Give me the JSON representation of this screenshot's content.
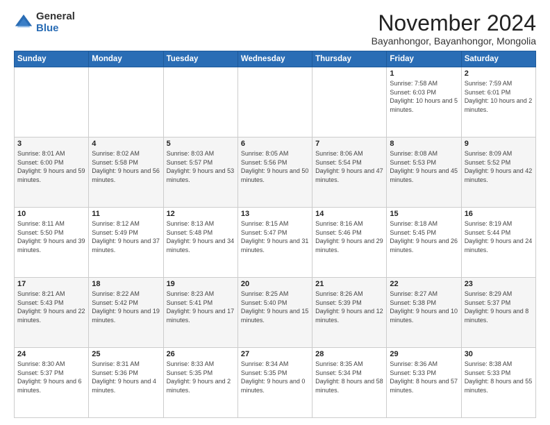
{
  "logo": {
    "general": "General",
    "blue": "Blue"
  },
  "header": {
    "month": "November 2024",
    "location": "Bayanhongor, Bayanhongor, Mongolia"
  },
  "weekdays": [
    "Sunday",
    "Monday",
    "Tuesday",
    "Wednesday",
    "Thursday",
    "Friday",
    "Saturday"
  ],
  "weeks": [
    [
      {
        "day": "",
        "info": ""
      },
      {
        "day": "",
        "info": ""
      },
      {
        "day": "",
        "info": ""
      },
      {
        "day": "",
        "info": ""
      },
      {
        "day": "",
        "info": ""
      },
      {
        "day": "1",
        "info": "Sunrise: 7:58 AM\nSunset: 6:03 PM\nDaylight: 10 hours\nand 5 minutes."
      },
      {
        "day": "2",
        "info": "Sunrise: 7:59 AM\nSunset: 6:01 PM\nDaylight: 10 hours\nand 2 minutes."
      }
    ],
    [
      {
        "day": "3",
        "info": "Sunrise: 8:01 AM\nSunset: 6:00 PM\nDaylight: 9 hours\nand 59 minutes."
      },
      {
        "day": "4",
        "info": "Sunrise: 8:02 AM\nSunset: 5:58 PM\nDaylight: 9 hours\nand 56 minutes."
      },
      {
        "day": "5",
        "info": "Sunrise: 8:03 AM\nSunset: 5:57 PM\nDaylight: 9 hours\nand 53 minutes."
      },
      {
        "day": "6",
        "info": "Sunrise: 8:05 AM\nSunset: 5:56 PM\nDaylight: 9 hours\nand 50 minutes."
      },
      {
        "day": "7",
        "info": "Sunrise: 8:06 AM\nSunset: 5:54 PM\nDaylight: 9 hours\nand 47 minutes."
      },
      {
        "day": "8",
        "info": "Sunrise: 8:08 AM\nSunset: 5:53 PM\nDaylight: 9 hours\nand 45 minutes."
      },
      {
        "day": "9",
        "info": "Sunrise: 8:09 AM\nSunset: 5:52 PM\nDaylight: 9 hours\nand 42 minutes."
      }
    ],
    [
      {
        "day": "10",
        "info": "Sunrise: 8:11 AM\nSunset: 5:50 PM\nDaylight: 9 hours\nand 39 minutes."
      },
      {
        "day": "11",
        "info": "Sunrise: 8:12 AM\nSunset: 5:49 PM\nDaylight: 9 hours\nand 37 minutes."
      },
      {
        "day": "12",
        "info": "Sunrise: 8:13 AM\nSunset: 5:48 PM\nDaylight: 9 hours\nand 34 minutes."
      },
      {
        "day": "13",
        "info": "Sunrise: 8:15 AM\nSunset: 5:47 PM\nDaylight: 9 hours\nand 31 minutes."
      },
      {
        "day": "14",
        "info": "Sunrise: 8:16 AM\nSunset: 5:46 PM\nDaylight: 9 hours\nand 29 minutes."
      },
      {
        "day": "15",
        "info": "Sunrise: 8:18 AM\nSunset: 5:45 PM\nDaylight: 9 hours\nand 26 minutes."
      },
      {
        "day": "16",
        "info": "Sunrise: 8:19 AM\nSunset: 5:44 PM\nDaylight: 9 hours\nand 24 minutes."
      }
    ],
    [
      {
        "day": "17",
        "info": "Sunrise: 8:21 AM\nSunset: 5:43 PM\nDaylight: 9 hours\nand 22 minutes."
      },
      {
        "day": "18",
        "info": "Sunrise: 8:22 AM\nSunset: 5:42 PM\nDaylight: 9 hours\nand 19 minutes."
      },
      {
        "day": "19",
        "info": "Sunrise: 8:23 AM\nSunset: 5:41 PM\nDaylight: 9 hours\nand 17 minutes."
      },
      {
        "day": "20",
        "info": "Sunrise: 8:25 AM\nSunset: 5:40 PM\nDaylight: 9 hours\nand 15 minutes."
      },
      {
        "day": "21",
        "info": "Sunrise: 8:26 AM\nSunset: 5:39 PM\nDaylight: 9 hours\nand 12 minutes."
      },
      {
        "day": "22",
        "info": "Sunrise: 8:27 AM\nSunset: 5:38 PM\nDaylight: 9 hours\nand 10 minutes."
      },
      {
        "day": "23",
        "info": "Sunrise: 8:29 AM\nSunset: 5:37 PM\nDaylight: 9 hours\nand 8 minutes."
      }
    ],
    [
      {
        "day": "24",
        "info": "Sunrise: 8:30 AM\nSunset: 5:37 PM\nDaylight: 9 hours\nand 6 minutes."
      },
      {
        "day": "25",
        "info": "Sunrise: 8:31 AM\nSunset: 5:36 PM\nDaylight: 9 hours\nand 4 minutes."
      },
      {
        "day": "26",
        "info": "Sunrise: 8:33 AM\nSunset: 5:35 PM\nDaylight: 9 hours\nand 2 minutes."
      },
      {
        "day": "27",
        "info": "Sunrise: 8:34 AM\nSunset: 5:35 PM\nDaylight: 9 hours\nand 0 minutes."
      },
      {
        "day": "28",
        "info": "Sunrise: 8:35 AM\nSunset: 5:34 PM\nDaylight: 8 hours\nand 58 minutes."
      },
      {
        "day": "29",
        "info": "Sunrise: 8:36 AM\nSunset: 5:33 PM\nDaylight: 8 hours\nand 57 minutes."
      },
      {
        "day": "30",
        "info": "Sunrise: 8:38 AM\nSunset: 5:33 PM\nDaylight: 8 hours\nand 55 minutes."
      }
    ]
  ]
}
